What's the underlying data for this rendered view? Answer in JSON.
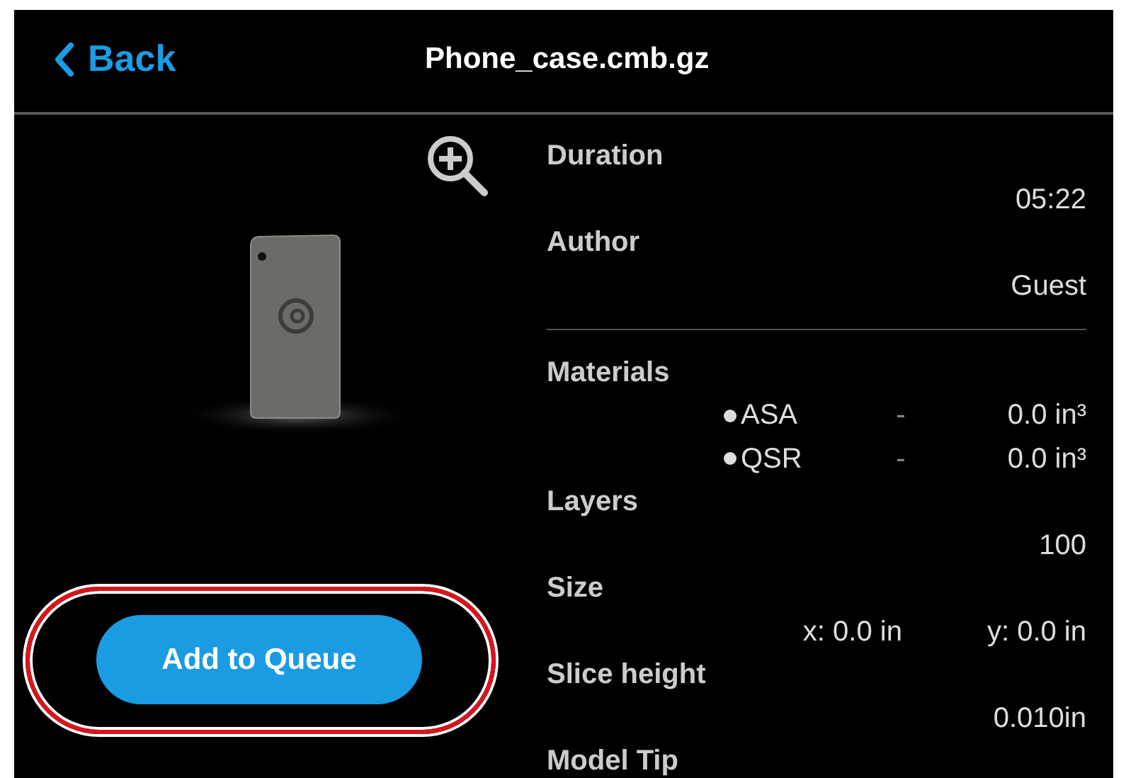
{
  "header": {
    "back_label": "Back",
    "title": "Phone_case.cmb.gz"
  },
  "preview": {
    "button_label": "Add to Queue",
    "highlighted": true
  },
  "summary": [
    {
      "kind": "text",
      "label": "Duration",
      "value": "05:22"
    },
    {
      "kind": "text",
      "label": "Author",
      "value": "Guest"
    }
  ],
  "specs": [
    {
      "kind": "materials",
      "label": "Materials",
      "items": [
        {
          "name": "ASA",
          "separator": "-",
          "amount": "0.0 in³"
        },
        {
          "name": "QSR",
          "separator": "-",
          "amount": "0.0 in³"
        }
      ]
    },
    {
      "kind": "text",
      "label": "Layers",
      "value": "100"
    },
    {
      "kind": "size",
      "label": "Size",
      "x": "x: 0.0 in",
      "y": "y: 0.0 in"
    },
    {
      "kind": "text",
      "label": "Slice height",
      "value": "0.010in"
    },
    {
      "kind": "text",
      "label": "Model Tip"
    }
  ]
}
